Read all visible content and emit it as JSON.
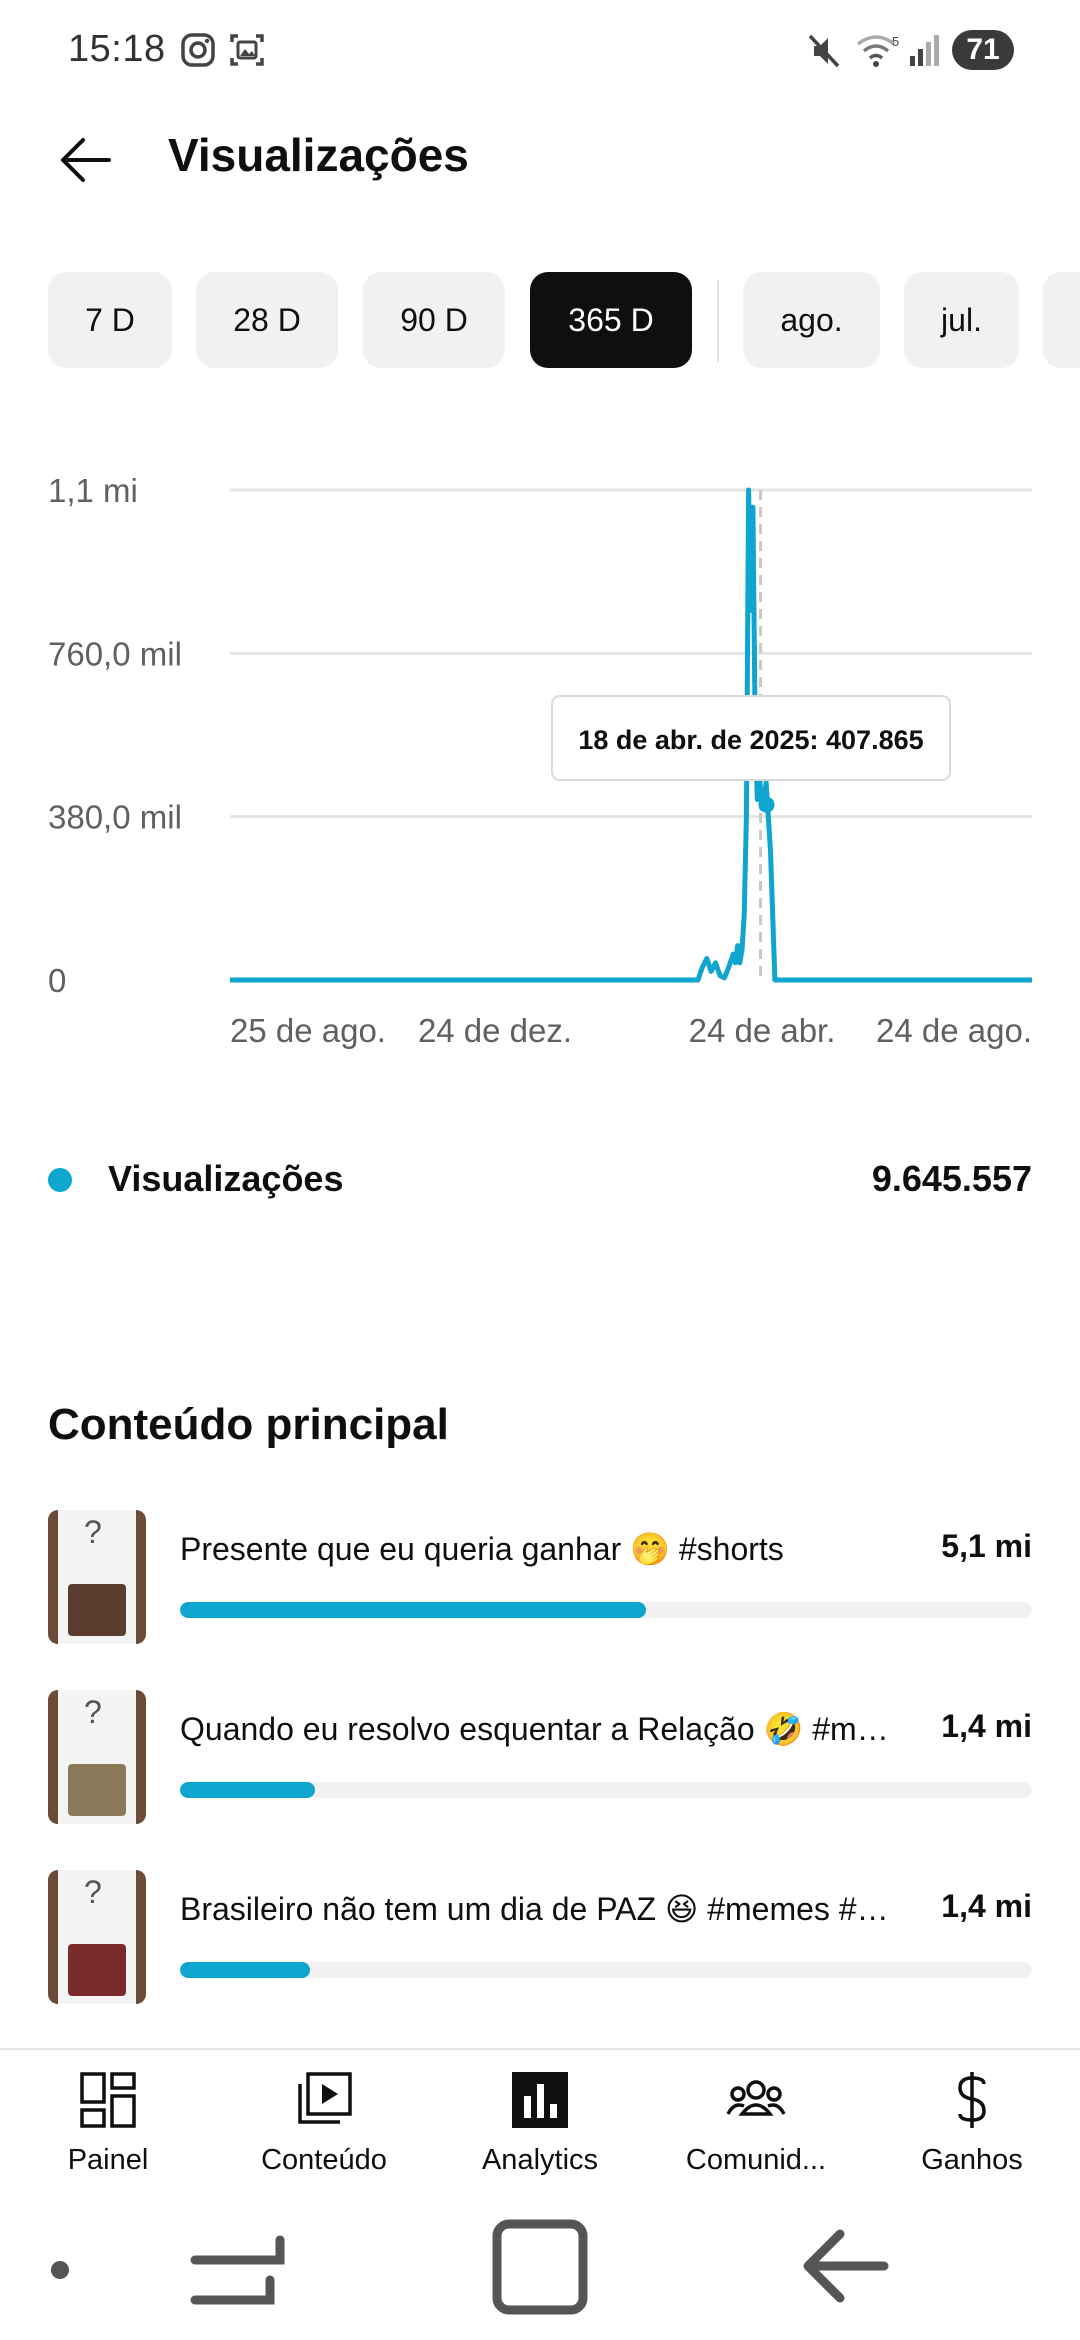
{
  "status": {
    "time": "15:18",
    "battery": "71",
    "icons": [
      "instagram-icon",
      "screenshot-icon",
      "mute-icon",
      "wifi-icon",
      "signal-icon"
    ]
  },
  "header": {
    "title": "Visualizações",
    "back_icon": "arrow-left-icon"
  },
  "chips": [
    {
      "label": "7 D",
      "active": false
    },
    {
      "label": "28 D",
      "active": false
    },
    {
      "label": "90 D",
      "active": false
    },
    {
      "label": "365 D",
      "active": true
    },
    {
      "label": "ago.",
      "active": false
    },
    {
      "label": "jul.",
      "active": false
    }
  ],
  "chart_data": {
    "type": "line",
    "title": "",
    "xlabel": "",
    "ylabel": "",
    "ylim": [
      0,
      1140000
    ],
    "yticks": [
      "1,1 mi",
      "760,0 mil",
      "380,0 mil",
      "0"
    ],
    "ytick_values": [
      1140000,
      760000,
      380000,
      0
    ],
    "xticks": [
      "25 de ago.",
      "24 de dez.",
      "24 de abr.",
      "24 de ago."
    ],
    "xtick_days": [
      0,
      121,
      242,
      365
    ],
    "grid": true,
    "color": "#0ea5cf",
    "series": [
      {
        "name": "Visualizações",
        "x": [
          0,
          213,
          215,
          217,
          219,
          221,
          223,
          225,
          227,
          229,
          230,
          231,
          232,
          233,
          234,
          235,
          236,
          237,
          238,
          239,
          240,
          241,
          242,
          243,
          244,
          245,
          246,
          248,
          365
        ],
        "values": [
          0,
          0,
          30000,
          50000,
          20000,
          40000,
          10000,
          5000,
          30000,
          60000,
          40000,
          80000,
          40000,
          70000,
          150000,
          380000,
          1140000,
          860000,
          1100000,
          600000,
          420000,
          480000,
          400000,
          407865,
          460000,
          380000,
          300000,
          0,
          0
        ]
      }
    ],
    "tooltip": {
      "text": "18 de abr. de 2025: 407.865",
      "day": 236,
      "marker_value": 407865
    }
  },
  "legend": {
    "label": "Visualizações",
    "value": "9.645.557"
  },
  "top_content": {
    "title": "Conteúdo principal",
    "items": [
      {
        "title": "Presente que eu queria ganhar 🤭 #shorts",
        "value": "5,1 mi",
        "fraction": 0.547,
        "thumb_color": "#5a3d2e"
      },
      {
        "title": "Quando eu resolvo esquentar a Relação 🤣 #memes #humor #comedia",
        "value": "1,4 mi",
        "fraction": 0.158,
        "thumb_color": "#8a7a5a"
      },
      {
        "title": "Brasileiro não tem um dia de PAZ 😆 #memes #humor",
        "value": "1,4 mi",
        "fraction": 0.152,
        "thumb_color": "#7a2a2a"
      }
    ]
  },
  "bottom_nav": [
    {
      "label": "Painel",
      "icon": "dashboard-icon"
    },
    {
      "label": "Conteúdo",
      "icon": "content-icon"
    },
    {
      "label": "Analytics",
      "icon": "analytics-icon",
      "active": true
    },
    {
      "label": "Comunid...",
      "icon": "community-icon"
    },
    {
      "label": "Ganhos",
      "icon": "dollar-icon"
    }
  ]
}
